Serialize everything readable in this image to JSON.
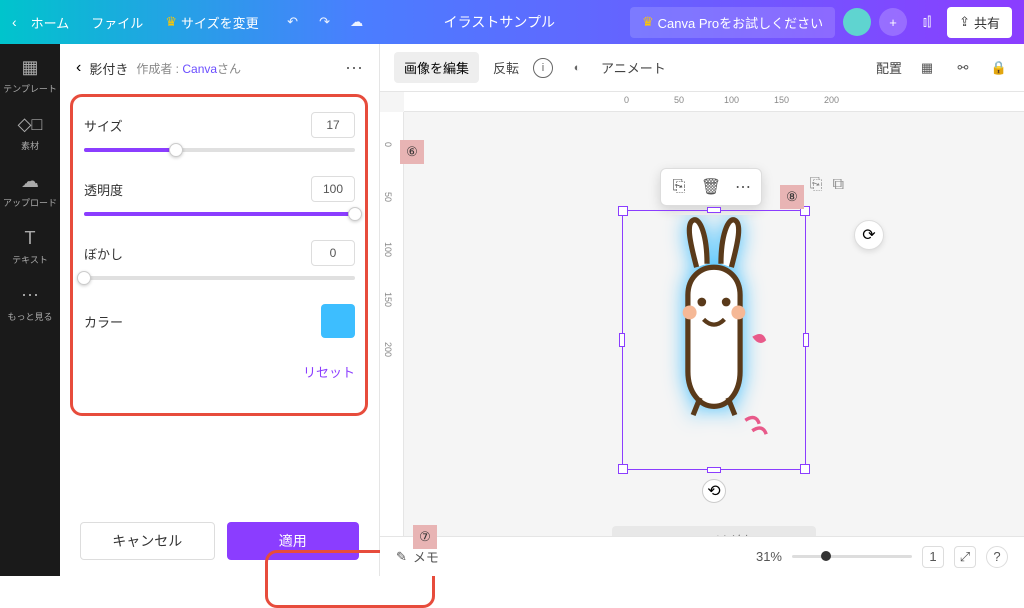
{
  "topbar": {
    "home": "ホーム",
    "file": "ファイル",
    "resize": "サイズを変更",
    "title": "イラストサンプル",
    "trial": "Canva Proをお試しください",
    "share": "共有"
  },
  "leftrail": {
    "template": "テンプレート",
    "elements": "素材",
    "upload": "アップロード",
    "text": "テキスト",
    "more": "もっと見る"
  },
  "panel": {
    "title": "影付き",
    "credit_label": "作成者 :",
    "credit_name": "Canva",
    "credit_suffix": "さん",
    "size_label": "サイズ",
    "size_val": "17",
    "opacity_label": "透明度",
    "opacity_val": "100",
    "blur_label": "ぼかし",
    "blur_val": "0",
    "color_label": "カラー",
    "color_hex": "#3dbeff",
    "reset": "リセット",
    "cancel": "キャンセル",
    "apply": "適用"
  },
  "context": {
    "edit_image": "画像を編集",
    "flip": "反転",
    "animate": "アニメート",
    "position": "配置"
  },
  "canvas": {
    "add_page": "＋ページを追加"
  },
  "ruler": {
    "marks": [
      "0",
      "50",
      "100",
      "150",
      "200"
    ]
  },
  "footer": {
    "notes": "メモ",
    "zoom": "31%",
    "page": "1"
  },
  "callouts": {
    "c6": "⑥",
    "c7": "⑦",
    "c8": "⑧"
  }
}
